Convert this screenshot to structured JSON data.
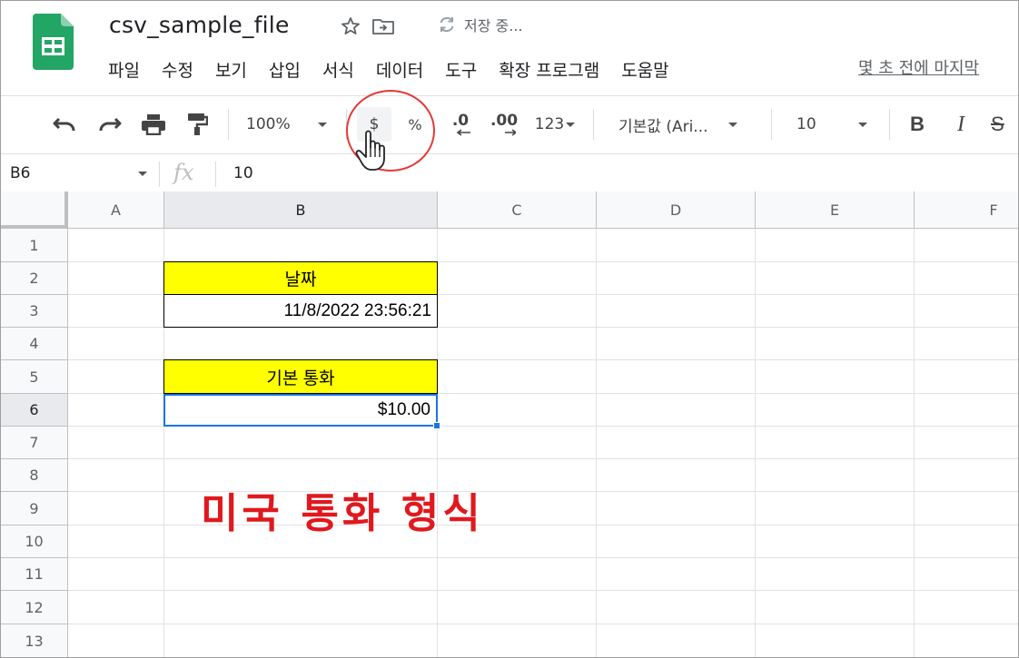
{
  "document": {
    "title": "csv_sample_file",
    "saving_status": "저장 중..."
  },
  "menu": {
    "items": [
      "파일",
      "수정",
      "보기",
      "삽입",
      "서식",
      "데이터",
      "도구",
      "확장 프로그램",
      "도움말"
    ],
    "last_edit": "몇 초 전에 마지막"
  },
  "toolbar": {
    "zoom": "100%",
    "currency": "$",
    "percent": "%",
    "decrease_decimal": ".0",
    "increase_decimal": ".00",
    "more_formats": "123",
    "font": "기본값 (Ari...",
    "font_size": "10",
    "bold": "B",
    "italic": "I",
    "strikethrough": "S"
  },
  "formula_bar": {
    "cell_ref": "B6",
    "fx": "fx",
    "value": "10"
  },
  "sheet": {
    "columns": [
      "A",
      "B",
      "C",
      "D",
      "E",
      "F"
    ],
    "rows": [
      "1",
      "2",
      "3",
      "4",
      "5",
      "6",
      "7",
      "8",
      "9",
      "10",
      "11",
      "12",
      "13"
    ],
    "active_column": "B",
    "active_row": "6",
    "cells": {
      "B2": "날짜",
      "B3": "11/8/2022 23:56:21",
      "B5": "기본 통화",
      "B6": "$10.00"
    },
    "header_fill": "#ffff00",
    "selection_color": "#1a73e8"
  },
  "annotation": {
    "text": "미국 통화 형식",
    "color": "#e0191e"
  }
}
